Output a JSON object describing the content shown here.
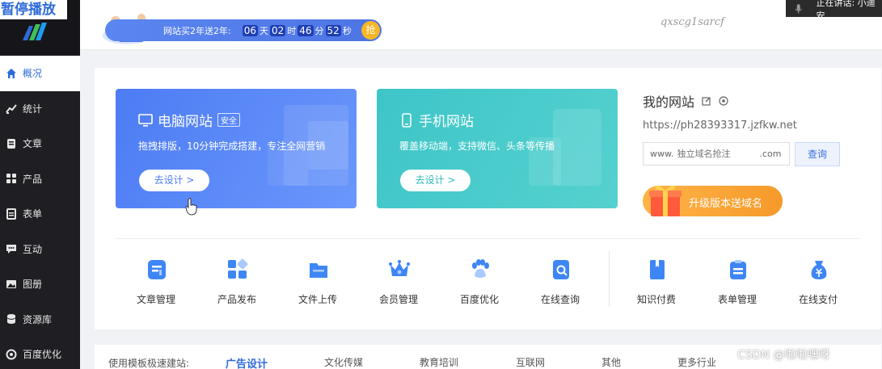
{
  "overlay": {
    "pause_text": "暂停播放",
    "speaking_text": "正在讲话: 小迪安"
  },
  "topbar": {
    "countdown_label": "网站买2年送2年:",
    "days": "06",
    "days_unit": "天",
    "hours": "02",
    "hours_unit": "时",
    "minutes": "46",
    "minutes_unit": "分",
    "seconds": "52",
    "seconds_unit": "秒",
    "grab_label": "抢",
    "signature": "qxscg1sarcf"
  },
  "sidebar": {
    "items": [
      {
        "label": "概况",
        "icon": "home-icon"
      },
      {
        "label": "统计",
        "icon": "chart-icon"
      },
      {
        "label": "文章",
        "icon": "article-icon"
      },
      {
        "label": "产品",
        "icon": "product-icon"
      },
      {
        "label": "表单",
        "icon": "form-icon"
      },
      {
        "label": "互动",
        "icon": "chat-icon"
      },
      {
        "label": "图册",
        "icon": "album-icon"
      },
      {
        "label": "资源库",
        "icon": "database-icon"
      },
      {
        "label": "百度优化",
        "icon": "seo-icon"
      }
    ]
  },
  "banners": {
    "pc": {
      "title": "电脑网站",
      "tag": "安全",
      "desc": "拖拽排版，10分钟完成搭建，专注全网营销",
      "button": "去设计 >"
    },
    "mobile": {
      "title": "手机网站",
      "desc": "覆盖移动端，支持微信、头条等传播",
      "button": "去设计 >"
    }
  },
  "mysite": {
    "title": "我的网站",
    "url": "https://ph28393317.jzfkw.net",
    "domain_prefix": "www.",
    "domain_placeholder": "独立域名抢注",
    "domain_suffix": ".com",
    "query_button": "查询",
    "upgrade_label": "升级版本送域名"
  },
  "tools": [
    {
      "label": "文章管理",
      "icon": "article-manage-icon"
    },
    {
      "label": "产品发布",
      "icon": "product-publish-icon"
    },
    {
      "label": "文件上传",
      "icon": "file-upload-icon"
    },
    {
      "label": "会员管理",
      "icon": "member-icon"
    },
    {
      "label": "百度优化",
      "icon": "paw-icon"
    },
    {
      "label": "在线查询",
      "icon": "search-doc-icon"
    },
    {
      "label": "知识付费",
      "icon": "book-icon"
    },
    {
      "label": "表单管理",
      "icon": "clipboard-icon"
    },
    {
      "label": "在线支付",
      "icon": "payment-icon"
    }
  ],
  "template_bar": {
    "lead": "使用模板极速建站:",
    "tabs": [
      "广告设计",
      "文化传媒",
      "教育培训",
      "互联网",
      "其他",
      "更多行业"
    ]
  },
  "watermark": "CSDN @啦啦嘿呀",
  "colors": {
    "accent": "#2f6bd8",
    "sidebar_bg": "#1f1f23",
    "pc_banner": "#4d7cf4",
    "mobile_banner": "#3ec5c8",
    "icon_blue": "#3e86f5"
  }
}
